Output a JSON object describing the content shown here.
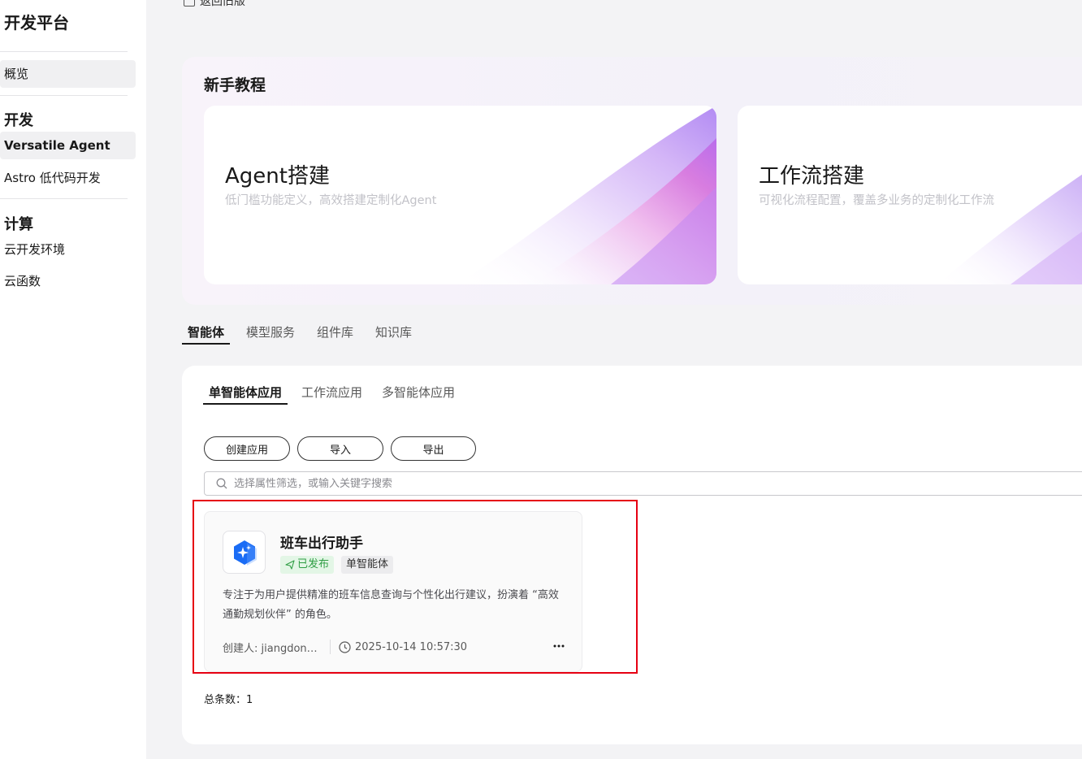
{
  "sidebar": {
    "brand": "开发平台",
    "items": [
      {
        "label": "概览"
      },
      {
        "label": "Versatile Agent"
      },
      {
        "label": "Astro 低代码开发"
      },
      {
        "label": "云开发环境"
      },
      {
        "label": "云函数"
      }
    ],
    "sections": [
      "开发",
      "计算"
    ]
  },
  "header": {
    "back_label": "返回旧版"
  },
  "tutorial": {
    "title": "新手教程",
    "cards": [
      {
        "title": "Agent搭建",
        "desc": "低门槛功能定义，高效搭建定制化Agent"
      },
      {
        "title": "工作流搭建",
        "desc": "可视化流程配置，覆盖多业务的定制化工作流"
      }
    ]
  },
  "main_tabs": [
    "智能体",
    "模型服务",
    "组件库",
    "知识库"
  ],
  "sub_tabs": [
    "单智能体应用",
    "工作流应用",
    "多智能体应用"
  ],
  "buttons": {
    "create": "创建应用",
    "import": "导入",
    "export": "导出"
  },
  "search": {
    "placeholder": "选择属性筛选，或输入关键字搜索"
  },
  "apps": [
    {
      "name": "班车出行助手",
      "status": "已发布",
      "type": "单智能体",
      "desc": "专注于为用户提供精准的班车信息查询与个性化出行建议，扮演着 “高效通勤规划伙伴” 的角色。",
      "creator": "创建人: jiangdong...",
      "time": "2025-10-14 10:57:30"
    }
  ],
  "total": {
    "label": "总条数：",
    "count": "1"
  },
  "colors": {
    "accent": "#191919",
    "published": "#2f9e44",
    "highlight": "#e60012",
    "logo": "#1a6cf5"
  }
}
